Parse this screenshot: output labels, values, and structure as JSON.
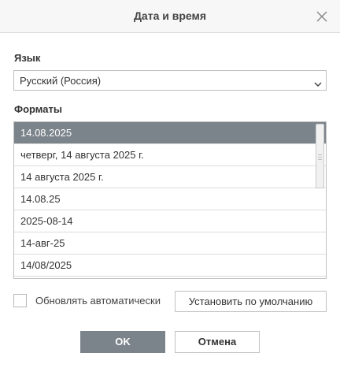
{
  "dialog": {
    "title": "Дата и время",
    "close_icon": "close-icon"
  },
  "language": {
    "label": "Язык",
    "selected": "Русский (Россия)",
    "arrow_icon": "chevron-down-icon"
  },
  "formats": {
    "label": "Форматы",
    "items": [
      "14.08.2025",
      "четверг, 14 августа 2025 г.",
      "14 августа 2025 г.",
      "14.08.25",
      "2025-08-14",
      "14-авг-25",
      "14/08/2025"
    ],
    "selected_index": 0
  },
  "auto_update": {
    "label": "Обновлять автоматически",
    "checked": false
  },
  "buttons": {
    "set_default": "Установить по умолчанию",
    "ok": "OK",
    "cancel": "Отмена"
  },
  "colors": {
    "selection": "#7c848b",
    "primary_button": "#7c848b"
  }
}
